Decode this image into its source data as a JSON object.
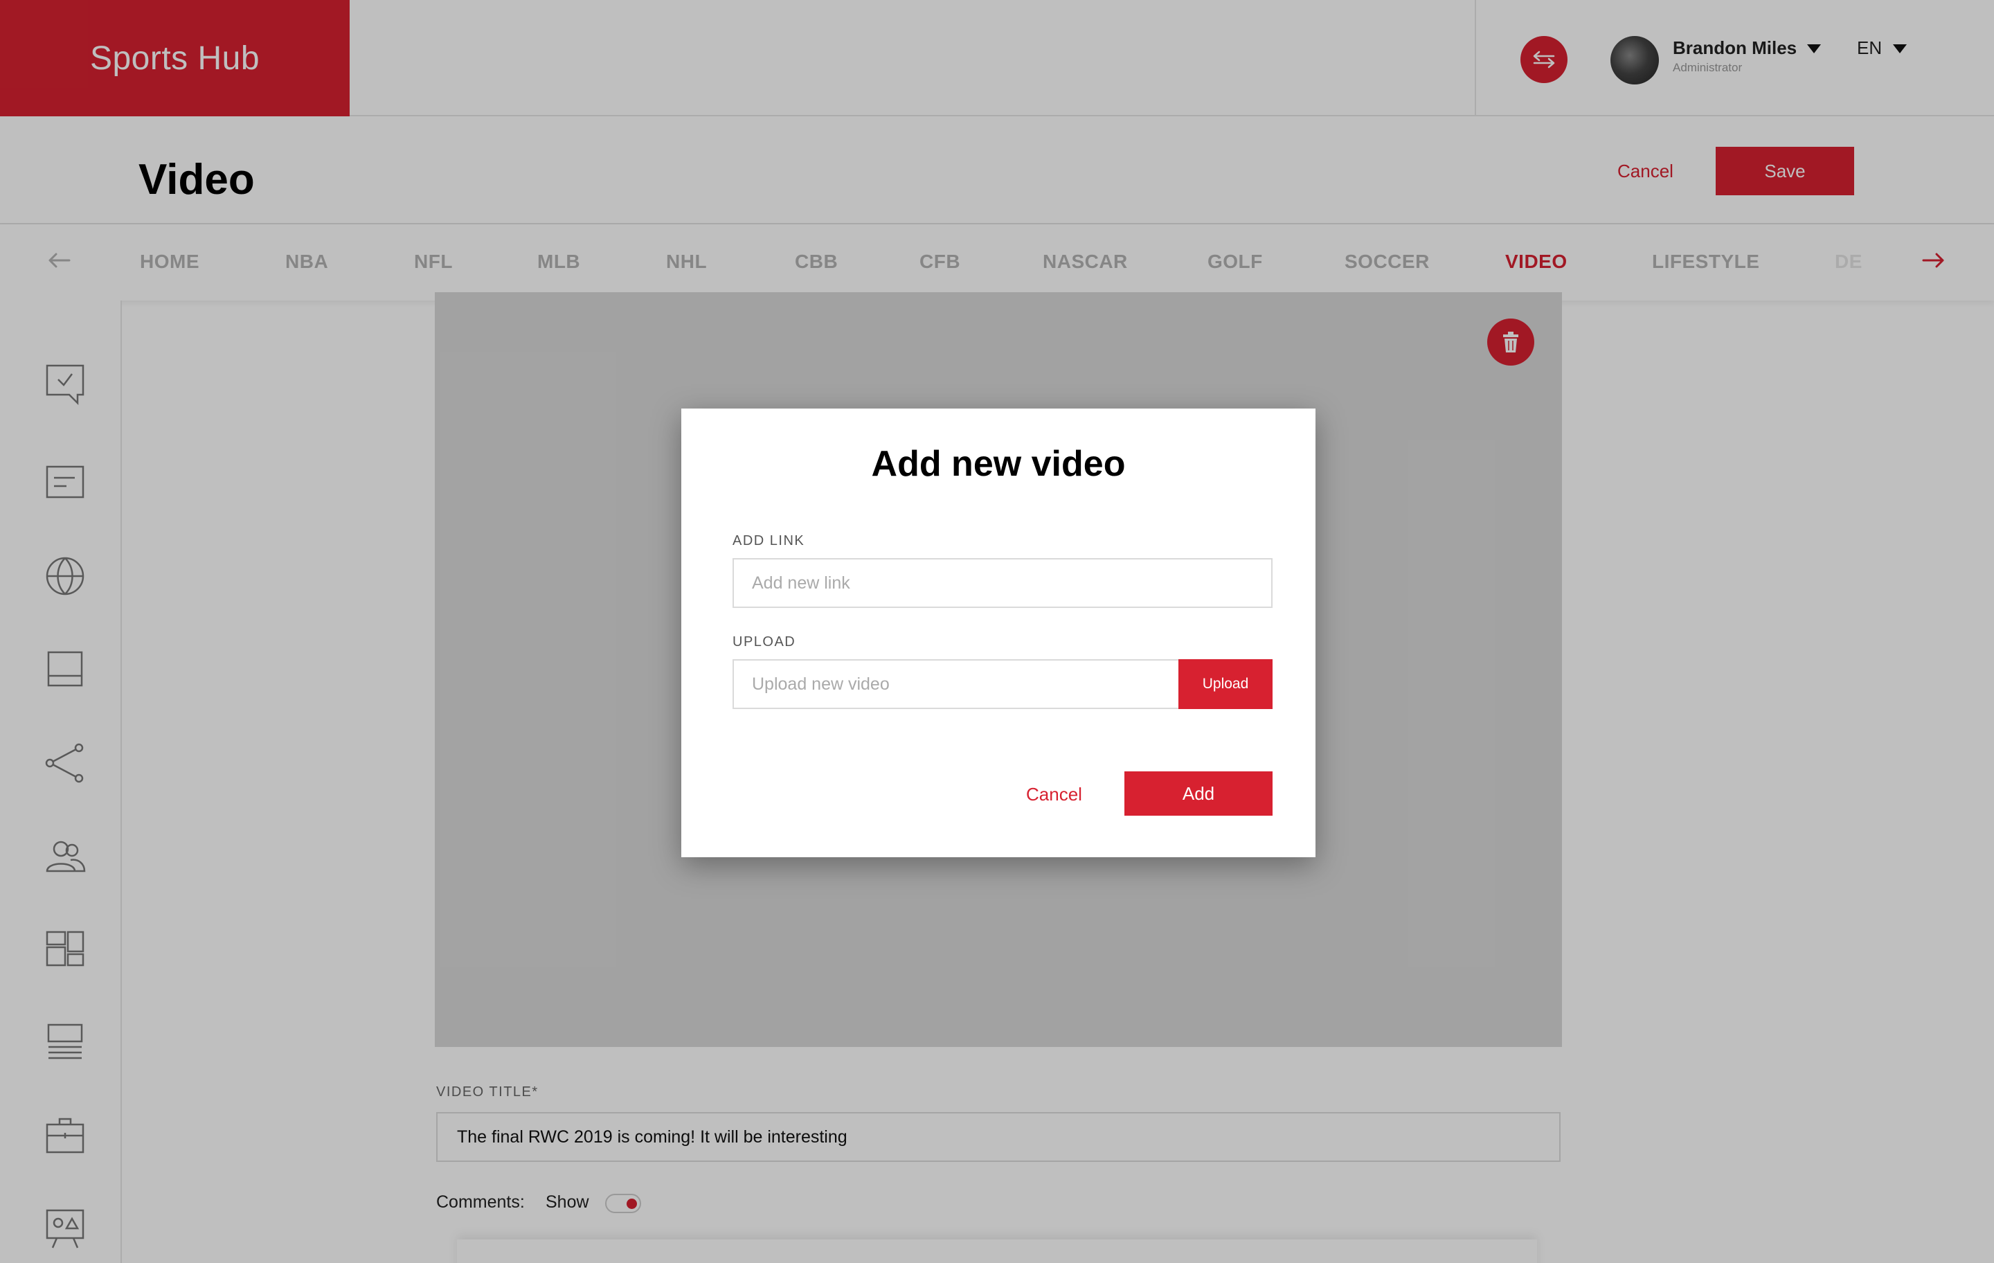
{
  "colors": {
    "accent": "#d72130",
    "muted_text": "#b3b3b3"
  },
  "header": {
    "logo": "Sports Hub",
    "user": {
      "name": "Brandon Miles",
      "role": "Administrator"
    },
    "language": "EN"
  },
  "page": {
    "title": "Video",
    "cancel_label": "Cancel",
    "save_label": "Save"
  },
  "categories": {
    "items": [
      "HOME",
      "NBA",
      "NFL",
      "MLB",
      "NHL",
      "CBB",
      "CFB",
      "NASCAR",
      "GOLF",
      "SOCCER",
      "VIDEO",
      "LIFESTYLE",
      "DE"
    ],
    "active": "VIDEO"
  },
  "sidebar": {
    "icons": [
      "survey-icon",
      "article-icon",
      "globe-icon",
      "layout-icon",
      "share-icon",
      "users-icon",
      "dashboard-icon",
      "list-icon",
      "briefcase-icon",
      "presentation-icon"
    ]
  },
  "form": {
    "video_title_label": "VIDEO TITLE*",
    "video_title_value": "The final RWC 2019  is coming! It will be interesting",
    "comments_label": "Comments:",
    "comments_state": "Show",
    "comments_enabled": true
  },
  "modal": {
    "title": "Add new video",
    "link_label": "ADD LINK",
    "link_placeholder": "Add new link",
    "upload_label": "UPLOAD",
    "upload_placeholder": "Upload new video",
    "upload_button": "Upload",
    "cancel_label": "Cancel",
    "add_label": "Add"
  }
}
